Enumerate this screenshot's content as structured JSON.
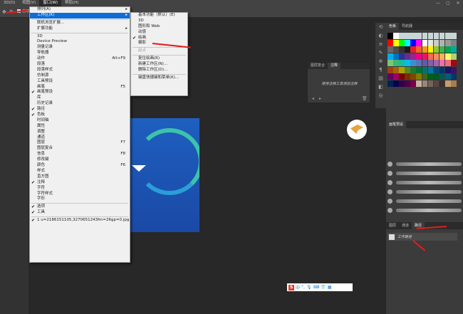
{
  "menubar": {
    "items": [
      "3D(D)",
      "视图(V)",
      "窗口(W)",
      "帮助(H)"
    ],
    "active_index": 2
  },
  "window_controls": [
    "—",
    "▢",
    "✕"
  ],
  "options_bar": {
    "auto_label": "自动"
  },
  "window_menu": {
    "items": [
      {
        "label": "排列(A)",
        "arrow": true
      },
      {
        "label": "工作区(K)",
        "arrow": true,
        "highlight": true
      },
      {
        "sep": true
      },
      {
        "label": "联机浏览扩展..."
      },
      {
        "label": "扩展功能",
        "arrow": true
      },
      {
        "sep": true
      },
      {
        "label": "3D"
      },
      {
        "label": "Device Preview"
      },
      {
        "label": "测量记录"
      },
      {
        "label": "导航器"
      },
      {
        "label": "动作",
        "shortcut": "Alt+F9"
      },
      {
        "label": "段落"
      },
      {
        "label": "段落样式"
      },
      {
        "label": "仿制源"
      },
      {
        "label": "工具预设"
      },
      {
        "label": "画笔",
        "shortcut": "F5"
      },
      {
        "label": "画笔预设",
        "checked": true
      },
      {
        "label": "库"
      },
      {
        "label": "历史记录"
      },
      {
        "label": "路径",
        "checked": true
      },
      {
        "label": "色板",
        "checked": true
      },
      {
        "label": "时间轴"
      },
      {
        "label": "属性"
      },
      {
        "label": "调整"
      },
      {
        "label": "通道"
      },
      {
        "label": "图层",
        "shortcut": "F7"
      },
      {
        "label": "图层复合"
      },
      {
        "label": "信息",
        "shortcut": "F8"
      },
      {
        "label": "修改键"
      },
      {
        "label": "颜色",
        "shortcut": "F6"
      },
      {
        "label": "样式"
      },
      {
        "label": "直方图"
      },
      {
        "label": "注释",
        "checked": true
      },
      {
        "label": "字符"
      },
      {
        "label": "字符样式"
      },
      {
        "label": "字形"
      },
      {
        "sep": true
      },
      {
        "label": "选项",
        "checked": true
      },
      {
        "label": "工具",
        "checked": true
      },
      {
        "sep": true
      },
      {
        "label": "1 u=2186151105,3270651243fm=26gp=0.jpg",
        "checked": true
      }
    ]
  },
  "workspace_submenu": {
    "items": [
      {
        "label": "基本功能（默认）(E)"
      },
      {
        "label": "3D"
      },
      {
        "label": "图形和 Web"
      },
      {
        "label": "动感"
      },
      {
        "label": "绘画",
        "checked": true
      },
      {
        "label": "摄影"
      },
      {
        "sep": true
      },
      {
        "label": "起点",
        "disabled": true
      },
      {
        "sep": true
      },
      {
        "label": "复位绘画(R)"
      },
      {
        "label": "新建工作区(N)..."
      },
      {
        "label": "删除工作区(D)..."
      },
      {
        "sep": true
      },
      {
        "label": "键盘快捷键和菜单(K)..."
      }
    ]
  },
  "right_panel": {
    "swatch_tabs": [
      "色板",
      "导航器"
    ],
    "brush_tab": "画笔预设",
    "bottom_tabs": [
      "图层",
      "通道",
      "路径"
    ],
    "bottom_active": 2,
    "path_item": "工作路径"
  },
  "float_panel": {
    "tabs": [
      "图层复合",
      "注释"
    ],
    "active": 1,
    "hint": "使用注释工具添加注释"
  },
  "colors": {
    "highlight": "#0f6ed6",
    "arrow": "#e81b1b",
    "bg": "#282828"
  },
  "swatch_colors": [
    "#000000",
    "#ffffff",
    "#c8d6d6",
    "#c8d6d6",
    "#c8d6d6",
    "#c8d6d6",
    "#c8d6d6",
    "#c8d6d6",
    "#c8d6d6",
    "#c8d6d6",
    "#c8d6d6",
    "#c8d6d6",
    "#ff0000",
    "#ffff00",
    "#00ff00",
    "#00ffff",
    "#0000ff",
    "#ff00ff",
    "#ffffff",
    "#e6e6e6",
    "#cccccc",
    "#b3b3b3",
    "#999999",
    "#808080",
    "#666666",
    "#4d4d4d",
    "#333333",
    "#1a1a1a",
    "#ed1c24",
    "#f26522",
    "#f7941d",
    "#fff200",
    "#8dc63f",
    "#39b54a",
    "#00a651",
    "#00a99d",
    "#00aeef",
    "#0072bc",
    "#2e3192",
    "#662d91",
    "#92278f",
    "#ec008c",
    "#ed145b",
    "#f26c4f",
    "#f68e56",
    "#fbaf5d",
    "#fff568",
    "#acd373",
    "#7cc576",
    "#3bb878",
    "#1abc9c",
    "#00bff3",
    "#438ccb",
    "#5674b9",
    "#605ca8",
    "#855fa8",
    "#a763a8",
    "#f06eaa",
    "#f26d7d",
    "#9e0b0f",
    "#a0410d",
    "#a36209",
    "#aba000",
    "#598527",
    "#1a7b30",
    "#007236",
    "#00746b",
    "#0076a3",
    "#004a80",
    "#003471",
    "#1b1464",
    "#440e62",
    "#630460",
    "#9e005d",
    "#790000",
    "#7b2e00",
    "#7d4900",
    "#827b00",
    "#406618",
    "#005e20",
    "#005826",
    "#005952",
    "#005b7f",
    "#003663",
    "#002157",
    "#0d004c",
    "#32004b",
    "#4b0049",
    "#7b0046",
    "#c7b299",
    "#998675",
    "#736357",
    "#534741",
    "#37302d",
    "#c69c6d",
    "#a67c52"
  ]
}
